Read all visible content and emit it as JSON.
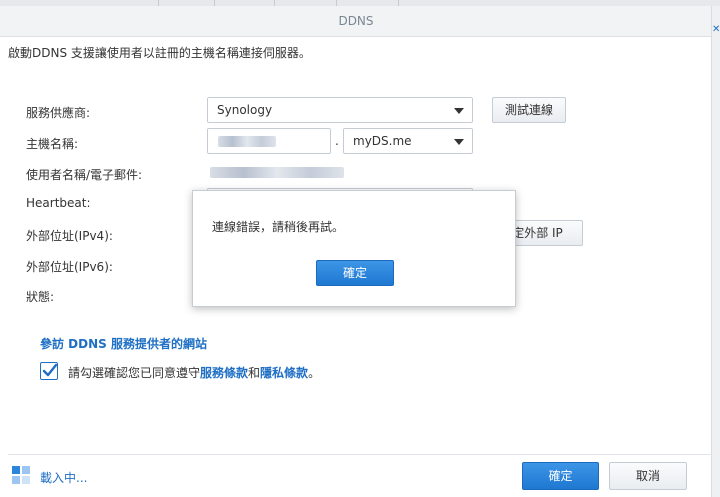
{
  "window": {
    "title": "DDNS"
  },
  "description": "啟動DDNS 支援讓使用者以註冊的主機名稱連接伺服器。",
  "form": {
    "provider_label": "服務供應商:",
    "provider_value": "Synology",
    "test_button": "測試連線",
    "hostname_label": "主機名稱:",
    "hostname_dot": ".",
    "domain_value": "myDS.me",
    "username_label": "使用者名稱/電子郵件:",
    "heartbeat_label": "Heartbeat:",
    "ipv4_label": "外部位址(IPv4):",
    "ipv4_button": "定外部 IP",
    "ipv6_label": "外部位址(IPv6):",
    "status_label": "狀態:"
  },
  "provider_link": "參訪 DDNS 服務提供者的網站",
  "agreement": {
    "checked": true,
    "prefix": "請勾選確認您已同意遵守",
    "terms_link": "服務條款",
    "and": "和",
    "privacy_link": "隱私條款",
    "suffix": "。"
  },
  "footer": {
    "loading_text": "載入中...",
    "ok_button": "確定",
    "cancel_button": "取消"
  },
  "alert": {
    "message": "連線錯誤，請稍後再試。",
    "ok_button": "確定"
  },
  "colors": {
    "accent": "#1f6fc5",
    "primary_button": "#2a86dc"
  },
  "icons": {
    "loading": "grid-loading-icon",
    "close": "close-icon",
    "dropdown": "chevron-down-icon",
    "check": "check-icon"
  }
}
